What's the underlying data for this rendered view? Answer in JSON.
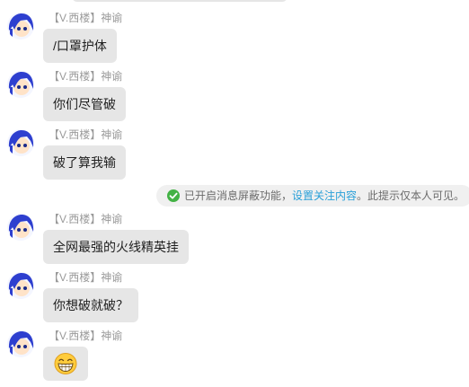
{
  "messages": [
    {
      "sender": "【V.西楼】神谕",
      "text": "/口罩护体"
    },
    {
      "sender": "【V.西楼】神谕",
      "text": "你们尽管破"
    },
    {
      "sender": "【V.西楼】神谕",
      "text": "破了算我输"
    },
    {
      "sender": "【V.西楼】神谕",
      "text": "全网最强的火线精英挂"
    },
    {
      "sender": "【V.西楼】神谕",
      "text": "你想破就破？"
    },
    {
      "sender": "【V.西楼】神谕",
      "emoji": "grinning-face-emoji"
    }
  ],
  "system_notice": {
    "prefix": "已开启消息屏蔽功能，",
    "link": "设置关注内容",
    "suffix": "。此提示仅本人可见。",
    "icon": "check-circle-icon",
    "icon_color": "#43b245",
    "link_color": "#2aa0d8"
  },
  "colors": {
    "bubble": "#e6e6e6",
    "sender": "#9a9a9a",
    "avatar_hair": "#2e3fcf"
  }
}
